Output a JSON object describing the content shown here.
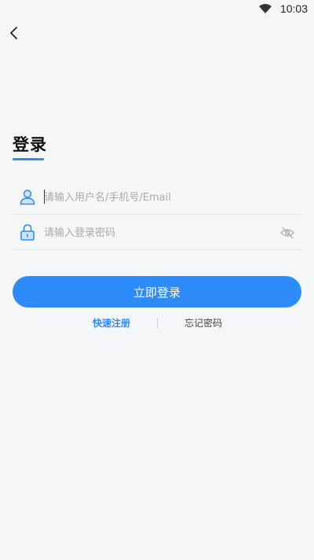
{
  "status_bar": {
    "time": "10:03",
    "wifi_icon": "wifi-icon"
  },
  "header": {
    "back_icon": "chevron-left-icon"
  },
  "login": {
    "title": "登录",
    "username": {
      "placeholder": "请输入用户名/手机号/Email",
      "value": "",
      "icon": "user-icon"
    },
    "password": {
      "placeholder": "请输入登录密码",
      "value": "",
      "icon": "lock-icon",
      "toggle_icon": "eye-off-icon"
    },
    "submit_label": "立即登录",
    "register_label": "快速注册",
    "forgot_label": "忘记密码"
  },
  "colors": {
    "accent": "#2e8cfa",
    "background": "#f5f6f7"
  }
}
